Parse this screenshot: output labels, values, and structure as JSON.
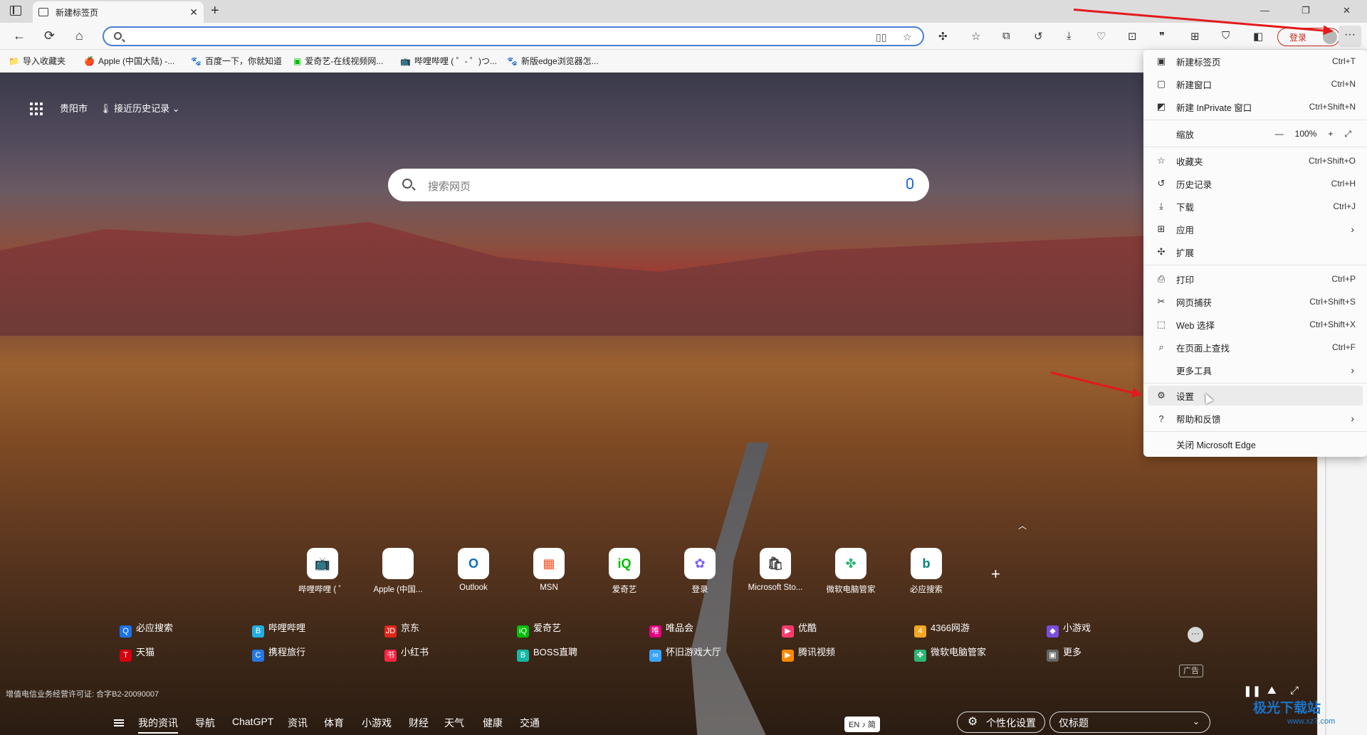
{
  "tab": {
    "title": "新建标签页",
    "close": "✕",
    "new": "+"
  },
  "window_controls": {
    "min": "—",
    "restore": "❐",
    "close": "✕"
  },
  "toolbar": {
    "back": "←",
    "refresh": "⟳",
    "home": "⌂",
    "address_value": "",
    "login": "登录",
    "more": "···"
  },
  "bookmarks": [
    {
      "label": "导入收藏夹",
      "icon": "📁"
    },
    {
      "label": "Apple (中国大陆) -...",
      "icon": "🍎"
    },
    {
      "label": "百度一下，你就知道",
      "icon": "🐾"
    },
    {
      "label": "爱奇艺-在线视频网...",
      "icon": "▣"
    },
    {
      "label": "哔哩哔哩 ( ゜- ゜)つ...",
      "icon": "📺"
    },
    {
      "label": "新版edge浏览器怎...",
      "icon": "🐾"
    }
  ],
  "header": {
    "city": "贵阳市",
    "history": "接近历史记录"
  },
  "search": {
    "placeholder": "搜索网页"
  },
  "quicklinks": [
    {
      "label": "哔哩哔哩 ( ゜",
      "icon": "📺",
      "color": "#23ade5"
    },
    {
      "label": "Apple (中国...",
      "icon": "",
      "color": "#111111"
    },
    {
      "label": "Outlook",
      "icon": "O",
      "color": "#0f6cbd"
    },
    {
      "label": "MSN",
      "icon": "▦",
      "color": "#f25022"
    },
    {
      "label": "爱奇艺",
      "icon": "iQ",
      "color": "#00be06"
    },
    {
      "label": "登录",
      "icon": "✿",
      "color": "#7b61ff"
    },
    {
      "label": "Microsoft Sto...",
      "icon": "🛍",
      "color": "#444444"
    },
    {
      "label": "微软电脑管家",
      "icon": "✤",
      "color": "#2bb673"
    },
    {
      "label": "必应搜索",
      "icon": "b",
      "color": "#008373"
    }
  ],
  "links_row1": [
    {
      "label": "必应搜索",
      "color": "#1a73e8",
      "icon": "Q"
    },
    {
      "label": "哔哩哔哩",
      "color": "#23ade5",
      "icon": "B"
    },
    {
      "label": "京东",
      "color": "#e1251b",
      "icon": "JD"
    },
    {
      "label": "爱奇艺",
      "color": "#00be06",
      "icon": "iQ"
    },
    {
      "label": "唯品会",
      "color": "#e4007f",
      "icon": "唯"
    },
    {
      "label": "优酷",
      "color": "#ff3a6e",
      "icon": "▶"
    },
    {
      "label": "4366网游",
      "color": "#f5a623",
      "icon": "4"
    },
    {
      "label": "小游戏",
      "color": "#7b4ce0",
      "icon": "◆"
    }
  ],
  "links_row2": [
    {
      "label": "天猫",
      "color": "#d6000f",
      "icon": "T"
    },
    {
      "label": "携程旅行",
      "color": "#2577e3",
      "icon": "C"
    },
    {
      "label": "小红书",
      "color": "#ff2442",
      "icon": "书"
    },
    {
      "label": "BOSS直聘",
      "color": "#15b8a6",
      "icon": "B"
    },
    {
      "label": "怀旧游戏大厅",
      "color": "#3aa7ff",
      "icon": "∞"
    },
    {
      "label": "腾讯视频",
      "color": "#ff8a00",
      "icon": "▶"
    },
    {
      "label": "微软电脑管家",
      "color": "#2bb673",
      "icon": "✤"
    },
    {
      "label": "更多",
      "color": "#666666",
      "icon": "▣"
    }
  ],
  "panel_more": "···",
  "ad_label": "广告",
  "license": "增值电信业务经营许可证: 合字B2-20090007",
  "bottom_nav": [
    "我的资讯",
    "导航",
    "ChatGPT",
    "资讯",
    "体育",
    "小游戏",
    "财经",
    "天气",
    "健康",
    "交通"
  ],
  "lang": "EN ♪ 简",
  "personalize": "个性化设置",
  "headline_mode": "仅标题",
  "menu": {
    "new_tab": {
      "label": "新建标签页",
      "shortcut": "Ctrl+T"
    },
    "new_window": {
      "label": "新建窗口",
      "shortcut": "Ctrl+N"
    },
    "new_inprivate": {
      "label": "新建 InPrivate 窗口",
      "shortcut": "Ctrl+Shift+N"
    },
    "zoom": {
      "label": "缩放",
      "value": "100%",
      "minus": "—",
      "plus": "+",
      "full": "⤢"
    },
    "favorites": {
      "label": "收藏夹",
      "shortcut": "Ctrl+Shift+O"
    },
    "history": {
      "label": "历史记录",
      "shortcut": "Ctrl+H"
    },
    "downloads": {
      "label": "下载",
      "shortcut": "Ctrl+J"
    },
    "apps": {
      "label": "应用"
    },
    "extensions": {
      "label": "扩展"
    },
    "print": {
      "label": "打印",
      "shortcut": "Ctrl+P"
    },
    "capture": {
      "label": "网页捕获",
      "shortcut": "Ctrl+Shift+S"
    },
    "web_select": {
      "label": "Web 选择",
      "shortcut": "Ctrl+Shift+X"
    },
    "find": {
      "label": "在页面上查找",
      "shortcut": "Ctrl+F"
    },
    "more_tools": {
      "label": "更多工具"
    },
    "settings": {
      "label": "设置"
    },
    "help": {
      "label": "帮助和反馈"
    },
    "close_edge": {
      "label": "关闭 Microsoft Edge"
    }
  },
  "watermark": {
    "title": "极光下载站",
    "url": "www.xz7.com"
  },
  "colors": {
    "accent": "#4a7fd4",
    "login_red": "#c42b1c",
    "annotation_arrow": "#e3191b"
  }
}
